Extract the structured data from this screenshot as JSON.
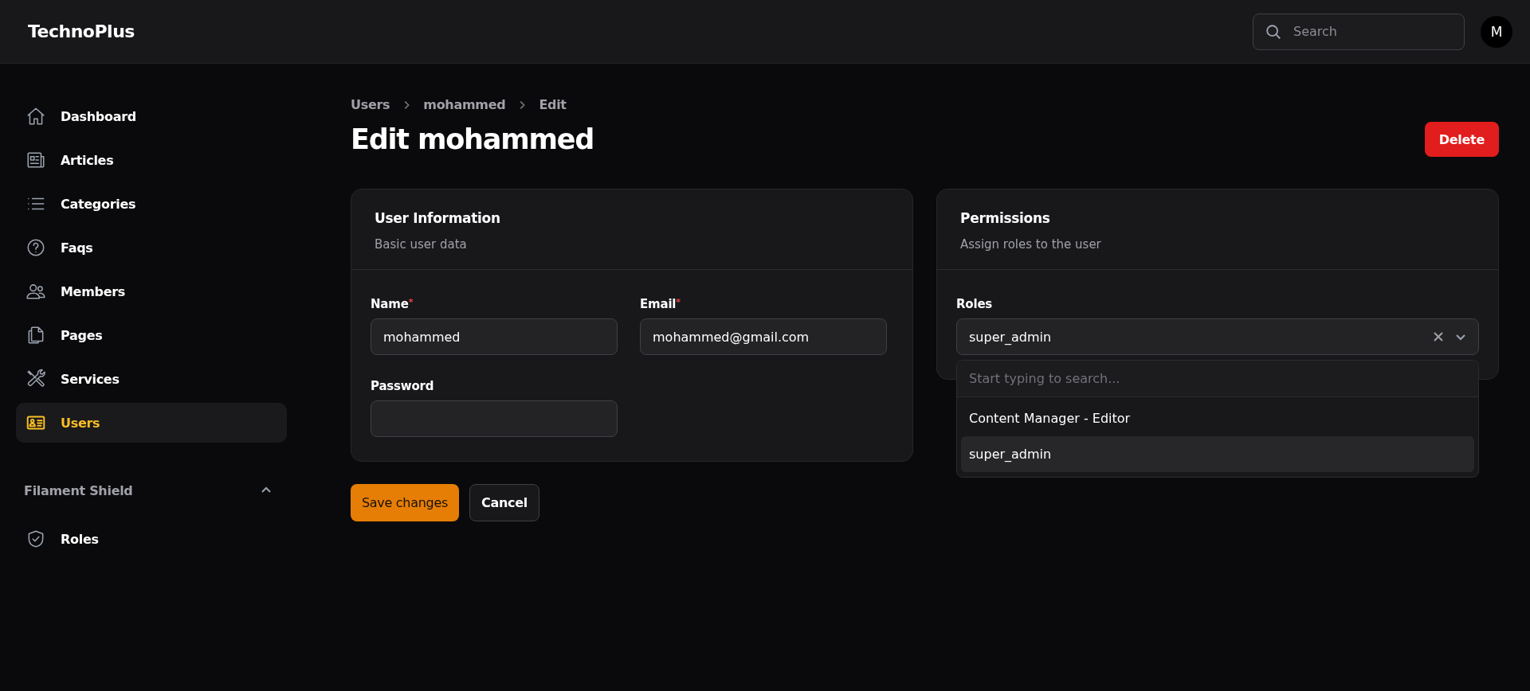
{
  "topbar": {
    "brand": "TechnoPlus",
    "search": {
      "placeholder": "Search"
    },
    "avatar": "M"
  },
  "sidebar": {
    "items": [
      {
        "label": "Dashboard",
        "selected": false
      },
      {
        "label": "Articles",
        "selected": false
      },
      {
        "label": "Categories",
        "selected": false
      },
      {
        "label": "Faqs",
        "selected": false
      },
      {
        "label": "Members",
        "selected": false
      },
      {
        "label": "Pages",
        "selected": false
      },
      {
        "label": "Services",
        "selected": false
      },
      {
        "label": "Users",
        "selected": true
      }
    ],
    "groups": [
      {
        "label": "Filament Shield",
        "expanded": true,
        "items": [
          {
            "label": "Roles",
            "selected": false
          }
        ]
      }
    ]
  },
  "breadcrumbs": [
    "Users",
    "mohammed",
    "Edit"
  ],
  "title": "Edit mohammed",
  "delete_button": "Delete",
  "user_card": {
    "title": "User Information",
    "subtitle": "Basic user data",
    "fields": [
      {
        "label": "Name",
        "required_mark": "*",
        "value": "mohammed"
      },
      {
        "label": "Email",
        "required_mark": "*",
        "value": "mohammed@gmail.com"
      },
      {
        "label": "Password"
      }
    ]
  },
  "permissions_card": {
    "title": "Permissions",
    "subtitle": "Assign roles to the user",
    "field": {
      "label": "Roles",
      "value": "super_admin",
      "dropdown": {
        "placeholder": "Start typing to search...",
        "options": [
          {
            "label": "Content Manager - Editor",
            "selected": false
          },
          {
            "label": "super_admin",
            "selected": true
          }
        ]
      }
    }
  },
  "actions": [
    "Save changes",
    "Cancel"
  ]
}
